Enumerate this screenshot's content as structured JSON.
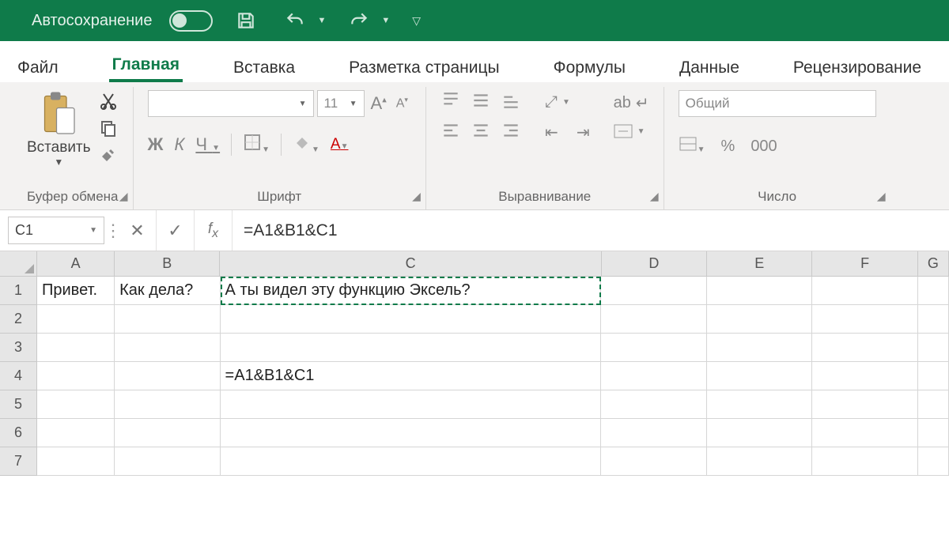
{
  "titlebar": {
    "autosave_label": "Автосохранение"
  },
  "tabs": {
    "file": "Файл",
    "home": "Главная",
    "insert": "Вставка",
    "layout": "Разметка страницы",
    "formulas": "Формулы",
    "data": "Данные",
    "review": "Рецензирование"
  },
  "ribbon": {
    "clipboard_caption": "Буфер обмена",
    "paste_label": "Вставить",
    "font_caption": "Шрифт",
    "font_name": "",
    "font_size": "11",
    "b": "Ж",
    "i": "К",
    "u": "Ч",
    "alignment_caption": "Выравнивание",
    "wrap_label": "ab",
    "number_caption": "Число",
    "number_format": "Общий",
    "percent": "%",
    "thousands": "000"
  },
  "namebox": {
    "ref": "C1"
  },
  "formula": "=A1&B1&C1",
  "grid": {
    "cols": [
      "A",
      "B",
      "C",
      "D",
      "E",
      "F",
      "G"
    ],
    "rows": [
      "1",
      "2",
      "3",
      "4",
      "5",
      "6",
      "7"
    ],
    "cells": {
      "A1": "Привет.",
      "B1": "Как дела?",
      "C1": "А ты видел эту функцию Эксель?",
      "C4": "=A1&B1&C1"
    },
    "active_cell": "C1"
  }
}
